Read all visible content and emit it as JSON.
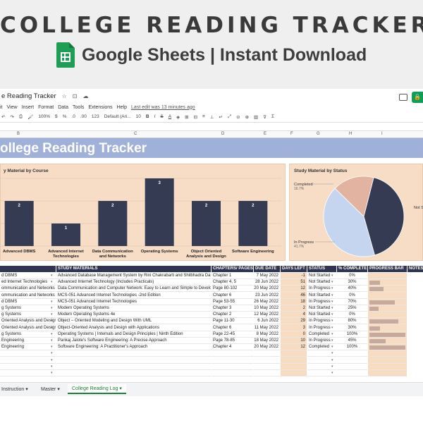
{
  "banner": {
    "title": "COLLEGE READING TRACKER",
    "subtitle": "Google Sheets | Instant Download"
  },
  "app": {
    "doc_title": "e Reading Tracker",
    "menu": [
      "it",
      "View",
      "Insert",
      "Format",
      "Data",
      "Tools",
      "Extensions",
      "Help"
    ],
    "last_edit": "Last edit was 13 minutes ago",
    "toolbar": {
      "zoom": "100%",
      "currency": "$",
      "percent": "%",
      "dec_less": ".0",
      "dec_more": ".00",
      "format_123": "123",
      "font": "Default (Ari...",
      "font_size": "10",
      "bold": "B",
      "italic": "I",
      "strike": "S",
      "text_color": "A"
    },
    "columns": [
      "B",
      "C",
      "D",
      "E",
      "F",
      "G",
      "H",
      "I"
    ]
  },
  "sheet": {
    "title": "ollege Reading Tracker"
  },
  "bar_chart": {
    "title": "y Material by Course",
    "color": "#353b52"
  },
  "chart_data": [
    {
      "type": "bar",
      "title": "y Material by Course",
      "categories": [
        "Advanced DBMS",
        "Advanced Internet Technologies",
        "Data Communication and Networks",
        "Operating Systems",
        "Object Oriented Analysis and Design",
        "Software Engineering"
      ],
      "category_lines": [
        [
          "Advanced DBMS"
        ],
        [
          "Advanced Internet",
          "Technologies"
        ],
        [
          "Data Communication",
          "and Networks"
        ],
        [
          "Operating Systems"
        ],
        [
          "Object Oriented",
          "Analysis and Design"
        ],
        [
          "Software Engineering"
        ]
      ],
      "values": [
        2,
        1,
        2,
        3,
        2,
        2
      ],
      "ylim": [
        0,
        3
      ],
      "grid": true
    },
    {
      "type": "pie",
      "title": "Study Material by Status",
      "slices": [
        {
          "label": "Not Started",
          "short_label": "Not S",
          "value": 41.7,
          "pct": "",
          "color": "#353b52"
        },
        {
          "label": "In Progress",
          "short_label": "In Progress",
          "value": 41.7,
          "pct": "41.7%",
          "color": "#c5d5f0"
        },
        {
          "label": "Completed",
          "short_label": "Completed",
          "value": 16.7,
          "pct": "16.7%",
          "color": "#e3b3a2"
        }
      ]
    }
  ],
  "pie_chart": {
    "title": "Study Material by Status"
  },
  "table": {
    "headers": [
      "",
      "STUDY MATERIALS",
      "CHAPTERS/ PAGES",
      "DUE DATE",
      "DAYS LEFT",
      "STATUS",
      "% COMPLETE",
      "PROGRESS BAR",
      "NOTES"
    ],
    "rows": [
      {
        "course": "d DBMS",
        "material": "Advanced Database Management System by Rini Chakrabarti and Shilbhadra Dasgupta",
        "chapters": "Chapter 1",
        "due": "7 May 2022",
        "days": "-1",
        "status": "Not Started",
        "pct": "0%",
        "progress": 0
      },
      {
        "course": "ed Internet Technologies",
        "material": "Advanced Internet Technology (Includes Practicals)",
        "chapters": "Chapter 4, 5",
        "due": "28 Jun 2022",
        "days": "51",
        "status": "Not Started",
        "pct": "30%",
        "progress": 0.3
      },
      {
        "course": "ommunication and Networks",
        "material": "Data Communication and Computer Network: Easy to Learn and Simple to Develop",
        "chapters": "Page 80-102",
        "due": "20 May 2022",
        "days": "12",
        "status": "In Progress",
        "pct": "40%",
        "progress": 0.4
      },
      {
        "course": "ommunication and Networks",
        "material": "MCS-051 Advanced Internet Technologies -2nd Edition",
        "chapters": "Chapter 6",
        "due": "23 Jun 2022",
        "days": "46",
        "status": "Not Started",
        "pct": "0%",
        "progress": 0
      },
      {
        "course": "d DBMS",
        "material": "MCS-051 Advanced Internet Technologies",
        "chapters": "Page 53-55",
        "due": "26 May 2022",
        "days": "18",
        "status": "In Progress",
        "pct": "70%",
        "progress": 0.7
      },
      {
        "course": "g Systems",
        "material": "Modern Operating Systems",
        "chapters": "Chapter 3",
        "due": "10 May 2022",
        "days": "2",
        "status": "Not Started",
        "pct": "25%",
        "progress": 0.25
      },
      {
        "course": "g Systems",
        "material": "Modern Operating Systems 4e",
        "chapters": "Chapter 2",
        "due": "12 May 2022",
        "days": "4",
        "status": "Not Started",
        "pct": "0%",
        "progress": 0
      },
      {
        "course": "Oriented Analysis and Design",
        "material": "Object – Oriented Modeling and Design With UML",
        "chapters": "Page 11-30",
        "due": "6 Jun 2022",
        "days": "29",
        "status": "In Progress",
        "pct": "80%",
        "progress": 0.8
      },
      {
        "course": "Oriented Analysis and Design",
        "material": "Object-Oriented Analysis and Design with Applications",
        "chapters": "Chapter 6",
        "due": "11 May 2022",
        "days": "3",
        "status": "In Progress",
        "pct": "30%",
        "progress": 0.3
      },
      {
        "course": "g Systems",
        "material": "Operating Systems | Internals and Design Principles | Ninth Edition",
        "chapters": "Page 22-45",
        "due": "8 May 2022",
        "days": "0",
        "status": "Completed",
        "pct": "100%",
        "progress": 1
      },
      {
        "course": "Engineering",
        "material": "Pankaj Jalote's Software Engineering: A Precise Approach",
        "chapters": "Page 78-85",
        "due": "18 May 2022",
        "days": "10",
        "status": "In Progress",
        "pct": "45%",
        "progress": 0.45
      },
      {
        "course": "Engineering",
        "material": "Software Engineering: A Practitioner's Approach",
        "chapters": "Chapter 4",
        "due": "20 May 2022",
        "days": "12",
        "status": "Completed",
        "pct": "100%",
        "progress": 1
      }
    ]
  },
  "tabs": [
    {
      "label": "Instruction",
      "active": false
    },
    {
      "label": "Master",
      "active": false
    },
    {
      "label": "College Reading Log",
      "active": true
    }
  ],
  "icons": {
    "star": "☆",
    "folder": "⊡",
    "cloud": "☁",
    "dropdown": "▾"
  }
}
